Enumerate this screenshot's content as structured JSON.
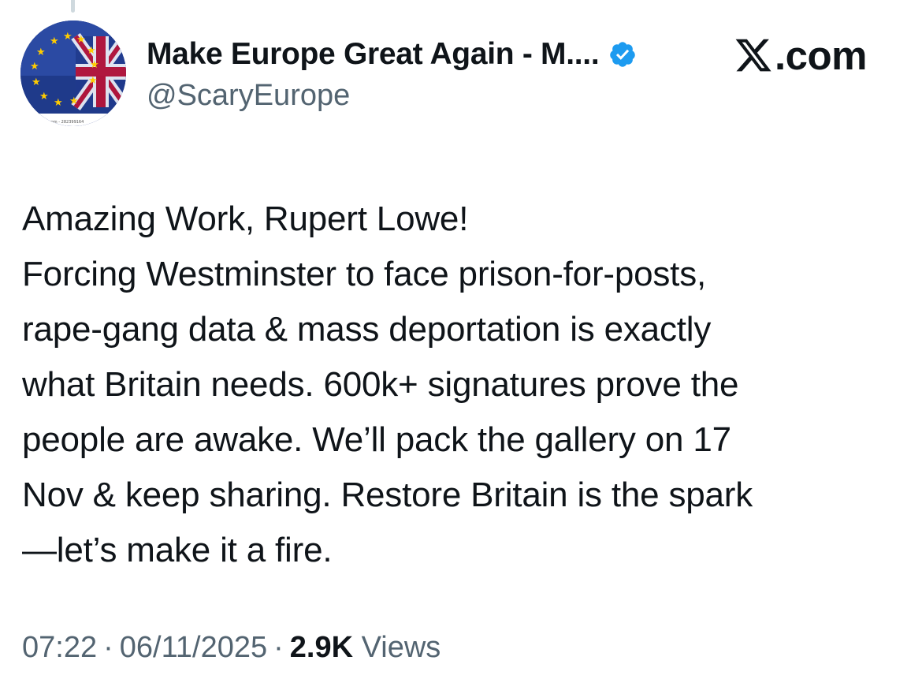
{
  "author": {
    "display_name": "Make Europe Great Again - M....",
    "handle": "@ScaryEurope",
    "verified": true,
    "avatar_caption": "com - 282399164"
  },
  "brand": {
    "text": ".com",
    "icon": "x-logo-icon"
  },
  "tweet": {
    "lines": [
      "Amazing Work, Rupert Lowe!",
      "Forcing Westminster to face prison-for-posts,",
      "rape-gang data & mass deportation is exactly",
      "what Britain needs. 600k+ signatures prove the",
      "people are awake. We’ll pack the gallery on 17",
      "Nov & keep sharing. Restore Britain is the spark",
      "—let’s make it a fire."
    ]
  },
  "meta": {
    "time": "07:22",
    "separator": "·",
    "date": "06/11/2025",
    "views_count": "2.9K",
    "views_label": "Views"
  },
  "colors": {
    "text_primary": "#0f1419",
    "text_secondary": "#536471",
    "verified_blue": "#1d9bf0",
    "eu_blue": "#1f3a8a",
    "union_red": "#c8102e",
    "eu_star": "#ffcc00"
  }
}
